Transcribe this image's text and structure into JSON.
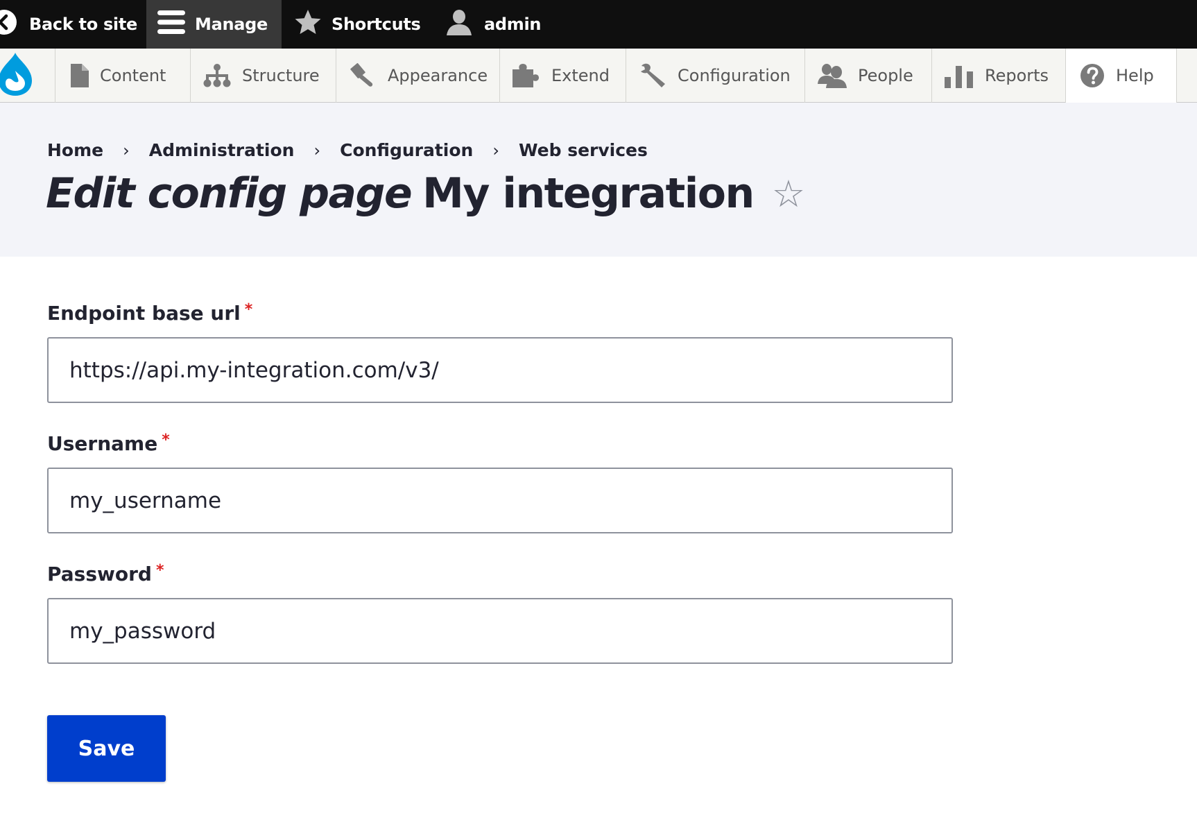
{
  "toolbar": {
    "back_to_site": "Back to site",
    "manage": "Manage",
    "shortcuts": "Shortcuts",
    "user": "admin"
  },
  "tray": {
    "items": [
      {
        "label": "Content",
        "icon": "page-icon"
      },
      {
        "label": "Structure",
        "icon": "sitemap-icon"
      },
      {
        "label": "Appearance",
        "icon": "paintbrush-icon"
      },
      {
        "label": "Extend",
        "icon": "puzzle-icon"
      },
      {
        "label": "Configuration",
        "icon": "wrench-icon"
      },
      {
        "label": "People",
        "icon": "people-icon"
      },
      {
        "label": "Reports",
        "icon": "bar-chart-icon"
      },
      {
        "label": "Help",
        "icon": "question-icon"
      }
    ]
  },
  "breadcrumb": {
    "items": [
      "Home",
      "Administration",
      "Configuration",
      "Web services"
    ],
    "separator": "›"
  },
  "page": {
    "title_emphasis": "Edit config page",
    "title_rest": "My integration",
    "favorite_star": "☆"
  },
  "form": {
    "required_marker": "*",
    "fields": [
      {
        "label": "Endpoint base url",
        "value": "https://api.my-integration.com/v3/"
      },
      {
        "label": "Username",
        "value": "my_username"
      },
      {
        "label": "Password",
        "value": "my_password"
      }
    ],
    "save_label": "Save"
  },
  "colors": {
    "toolbar_bg": "#0f0f0f",
    "manage_active_bg": "#383838",
    "tray_bg": "#f5f5f2",
    "header_bg": "#f3f4f9",
    "drupal_blue": "#009cde",
    "primary_button": "#003ecc",
    "required": "#dc2323",
    "text": "#222330"
  }
}
